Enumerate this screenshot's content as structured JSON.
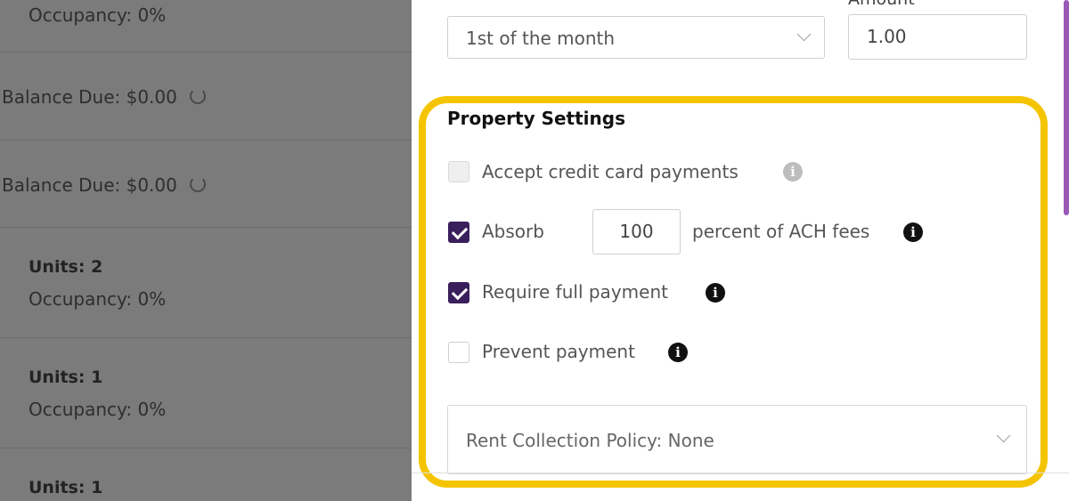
{
  "left_list": {
    "rows": [
      {
        "occupancy": "Occupancy: 0%"
      },
      {
        "balance": "Balance Due: $0.00"
      },
      {
        "balance": "Balance Due: $0.00"
      },
      {
        "units": "Units: 2",
        "occupancy": "Occupancy: 0%"
      },
      {
        "units": "Units: 1",
        "occupancy": "Occupancy: 0%"
      },
      {
        "units": "Units: 1"
      }
    ]
  },
  "payment_schedule": {
    "due_select_value": "1st of the month",
    "amount_label": "Amount",
    "amount_value": "1.00"
  },
  "property_settings": {
    "title": "Property Settings",
    "accept_credit": {
      "label": "Accept credit card payments",
      "checked": false,
      "disabled": true
    },
    "absorb": {
      "label_before": "Absorb",
      "value": "100",
      "label_after": "percent of ACH fees",
      "checked": true
    },
    "require_full": {
      "label": "Require full payment",
      "checked": true
    },
    "prevent": {
      "label": "Prevent payment",
      "checked": false
    },
    "rent_policy": "Rent Collection Policy: None"
  },
  "colors": {
    "highlight": "#f5c400",
    "checkbox_checked": "#3a1f5d",
    "scrollbar": "#9b59b6"
  },
  "icons": [
    "chevron-down-icon",
    "info-icon",
    "spinner-icon",
    "check-icon"
  ]
}
